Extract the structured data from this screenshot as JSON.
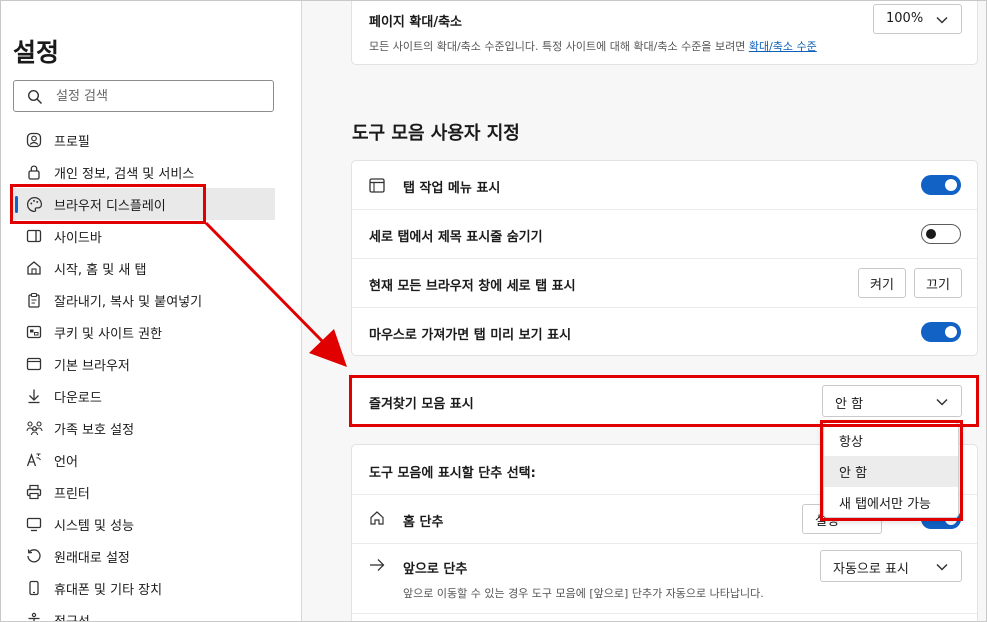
{
  "sidebar": {
    "title": "설정",
    "search_placeholder": "설정 검색",
    "items": [
      {
        "label": "프로필",
        "icon": "profile-icon"
      },
      {
        "label": "개인 정보, 검색 및 서비스",
        "icon": "lock-icon"
      },
      {
        "label": "브라우저 디스플레이",
        "icon": "palette-icon",
        "active": true
      },
      {
        "label": "사이드바",
        "icon": "sidebar-icon"
      },
      {
        "label": "시작, 홈 및 새 탭",
        "icon": "home-grid-icon"
      },
      {
        "label": "잘라내기, 복사 및 붙여넣기",
        "icon": "clipboard-icon"
      },
      {
        "label": "쿠키 및 사이트 권한",
        "icon": "cookie-icon"
      },
      {
        "label": "기본 브라우저",
        "icon": "browser-icon"
      },
      {
        "label": "다운로드",
        "icon": "download-icon"
      },
      {
        "label": "가족 보호 설정",
        "icon": "family-icon"
      },
      {
        "label": "언어",
        "icon": "language-icon"
      },
      {
        "label": "프린터",
        "icon": "printer-icon"
      },
      {
        "label": "시스템 및 성능",
        "icon": "system-icon"
      },
      {
        "label": "원래대로 설정",
        "icon": "reset-icon"
      },
      {
        "label": "휴대폰 및 기타 장치",
        "icon": "phone-icon"
      },
      {
        "label": "접근성",
        "icon": "accessibility-icon"
      }
    ]
  },
  "zoom": {
    "label": "페이지 확대/축소",
    "value": "100%",
    "desc": "모든 사이트의 확대/축소 수준입니다. 특정 사이트에 대해 확대/축소 수준을 보려면 ",
    "link": "확대/축소 수준"
  },
  "toolbar_section": {
    "title": "도구 모음 사용자 지정",
    "rows": [
      {
        "label": "탭 작업 메뉴 표시",
        "toggle": "on"
      },
      {
        "label": "세로 탭에서 제목 표시줄 숨기기",
        "toggle": "off"
      },
      {
        "label": "현재 모든 브라우저 창에 세로 탭 표시",
        "on_label": "켜기",
        "off_label": "끄기"
      },
      {
        "label": "마우스로 가져가면 탭 미리 보기 표시",
        "toggle": "on"
      }
    ]
  },
  "favorites": {
    "label": "즐겨찾기 모음 표시",
    "value": "안 함",
    "options": [
      "항상",
      "안 함",
      "새 탭에서만 가능"
    ]
  },
  "buttons_section": {
    "title": "도구 모음에 표시할 단추 선택:",
    "home_label": "홈 단추",
    "home_btn_partial": "설정",
    "forward_label": "앞으로 단추",
    "forward_value": "자동으로 표시",
    "forward_desc": "앞으로 이동할 수 있는 경우 도구 모음에 [앞으로] 단추가 자동으로 나타납니다."
  },
  "colors": {
    "accent": "#1261c4",
    "highlight": "#e00000"
  }
}
